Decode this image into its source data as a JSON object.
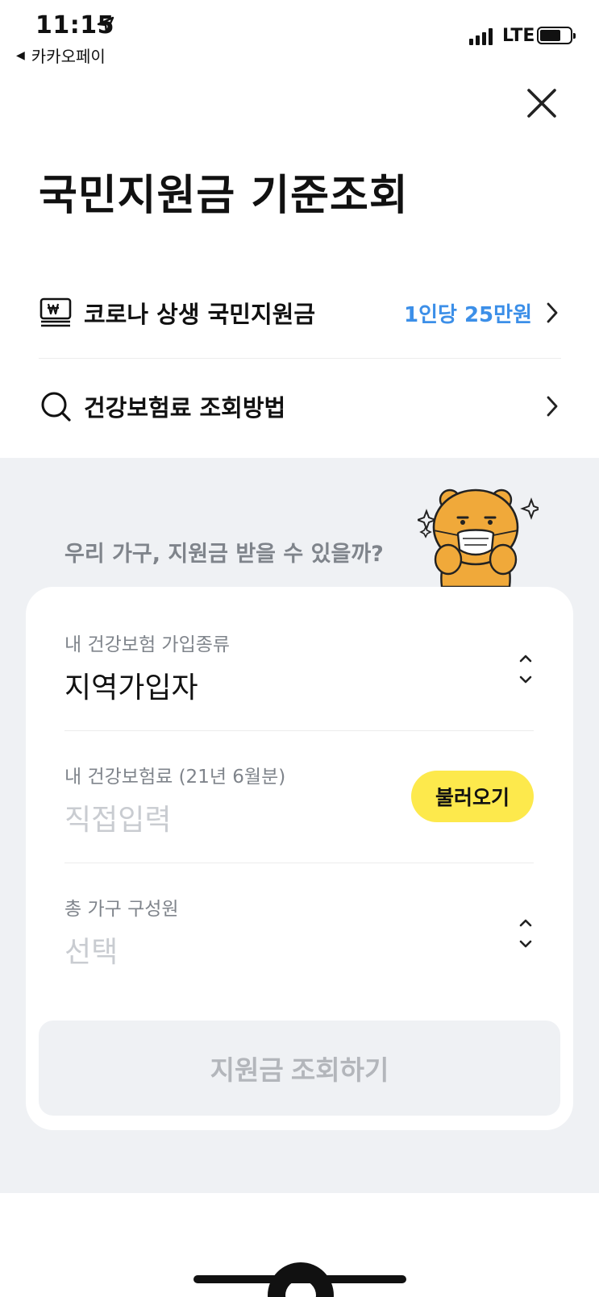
{
  "status_bar": {
    "time": "11:15",
    "back_app": "카카오페이",
    "network": "LTE"
  },
  "page": {
    "title": "국민지원금 기준조회"
  },
  "menu": [
    {
      "icon": "won-bill-icon",
      "label": "코로나 상생 국민지원금",
      "value": "1인당 25만원"
    },
    {
      "icon": "search-icon",
      "label": "건강보험료 조회방법"
    }
  ],
  "form": {
    "question": "우리 가구, 지원금 받을 수 있을까?",
    "fields": [
      {
        "label": "내 건강보험 가입종류",
        "value": "지역가입자"
      },
      {
        "label": "내 건강보험료 (21년 6월분)",
        "placeholder": "직접입력",
        "button": "불러오기"
      },
      {
        "label": "총 가구 구성원",
        "placeholder": "선택"
      }
    ],
    "submit": "지원금 조회하기"
  },
  "colors": {
    "accent_blue": "#3c8fe8",
    "button_yellow": "#fde94c",
    "section_gray": "#eff1f4",
    "placeholder_gray": "#c9ccd1"
  }
}
